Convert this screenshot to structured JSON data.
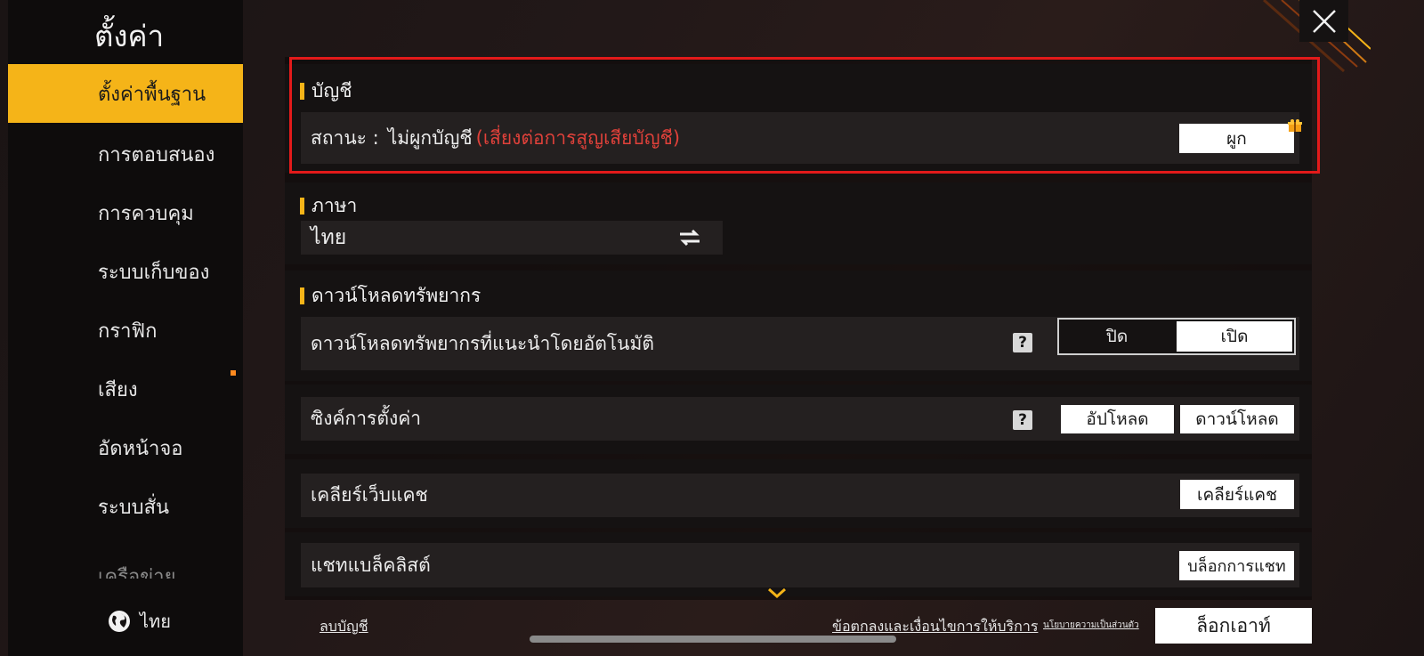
{
  "sidebar": {
    "title": "ตั้งค่า",
    "items": [
      {
        "label": "ตั้งค่าพื้นฐาน",
        "active": true
      },
      {
        "label": "การตอบสนอง"
      },
      {
        "label": "การควบคุม"
      },
      {
        "label": "ระบบเก็บของ"
      },
      {
        "label": "กราฟิก"
      },
      {
        "label": "เสียง"
      },
      {
        "label": "อัดหน้าจอ"
      },
      {
        "label": "ระบบสั่น"
      },
      {
        "label": "เครือข่าย"
      }
    ],
    "language_label": "ไทย",
    "language_icon": "globe-icon"
  },
  "account": {
    "heading": "บัญชี",
    "status_prefix": "สถานะ :",
    "status_value": "ไม่ผูกบัญชี",
    "status_warning": "(เสี่ยงต่อการสูญเสียบัญชี)",
    "bind_button": "ผูก",
    "gift_icon": "gift-icon",
    "warning_color": "#e0413a"
  },
  "language": {
    "heading": "ภาษา",
    "current": "ไทย",
    "switch_icon": "swap-arrows-icon"
  },
  "download": {
    "heading": "ดาวน์โหลดทรัพยากร",
    "auto_label": "ดาวน์โหลดทรัพยากรที่แนะนำโดยอัตโนมัติ",
    "toggle_off": "ปิด",
    "toggle_on": "เปิด",
    "selected": "เปิด"
  },
  "sync": {
    "label": "ซิงค์การตั้งค่า",
    "upload_button": "อัปโหลด",
    "download_button": "ดาวน์โหลด"
  },
  "cache": {
    "label": "เคลียร์เว็บแคช",
    "button": "เคลียร์แคช"
  },
  "chat": {
    "label": "แชทแบล็คลิสต์",
    "button": "บล็อกการแชท"
  },
  "footer": {
    "delete_account": "ลบบัญชี",
    "terms": "ข้อตกลงและเงื่อนไขการให้บริการ",
    "privacy": "นโยบายความเป็นส่วนตัว",
    "logout": "ล็อกเอาท์"
  },
  "colors": {
    "accent": "#f5b418",
    "highlight_frame": "#e31a1a"
  }
}
